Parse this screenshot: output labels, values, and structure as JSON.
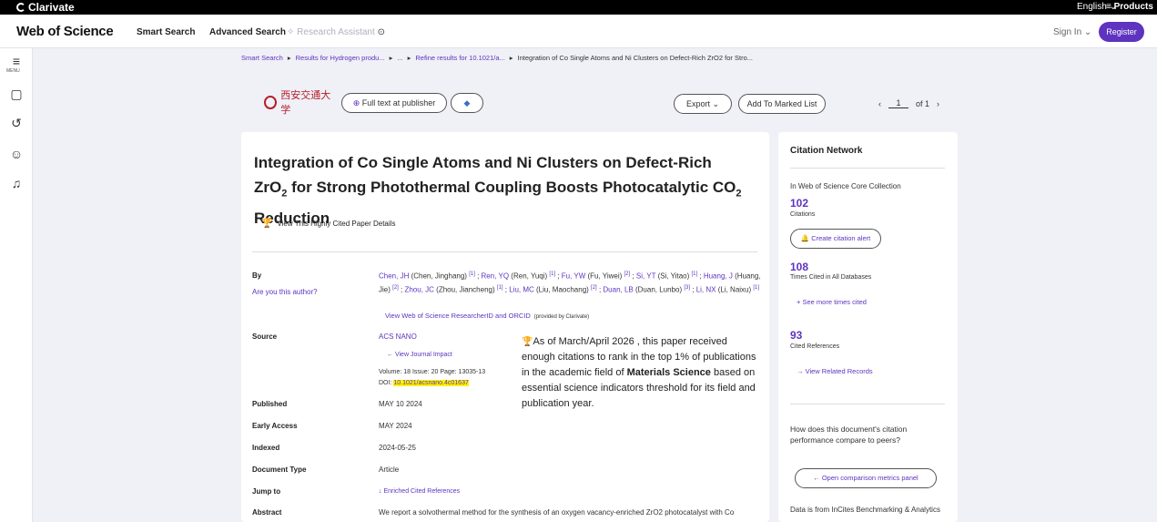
{
  "topbar": {
    "logo": "Clarivate",
    "language": "English ⌄",
    "products": "≡ Products"
  },
  "header": {
    "brand": "Web of Science",
    "nav": [
      "Smart Search",
      "Advanced Search",
      "Research Assistant"
    ],
    "sign_in": "Sign In ⌄",
    "register": "Register"
  },
  "rail": {
    "menu_label": "MENU"
  },
  "breadcrumb": {
    "items": [
      "Smart Search",
      "Results for Hydrogen produ...",
      "...",
      "Refine results for 10.1021/a...",
      "Integration of Co Single Atoms and Ni Clusters on Defect-Rich ZrO2 for Stro..."
    ]
  },
  "toolbar": {
    "university": "西安交通大学",
    "full_text": "Full text at publisher",
    "export": "Export ⌄",
    "marked_list": "Add To Marked List",
    "page_current": "1",
    "page_total": "of 1"
  },
  "record": {
    "title_a": "Integration of Co Single Atoms and Ni Clusters on Defect-Rich ZrO",
    "title_sub1": "2",
    "title_b": " for Strong Photothermal Coupling Boosts Photocatalytic CO",
    "title_sub2": "2",
    "title_c": " Reduction",
    "highly_cited_link": "View This Highly Cited Paper Details",
    "labels": {
      "by": "By",
      "source": "Source",
      "published": "Published",
      "early_access": "Early Access",
      "indexed": "Indexed",
      "doc_type": "Document Type",
      "jump_to": "Jump to",
      "abstract": "Abstract"
    },
    "are_you_author": "Are you this author?",
    "authors": [
      {
        "short": "Chen, JH",
        "full": " (Chen, Jinghang) ",
        "aff": "[1]"
      },
      {
        "short": "Ren, YQ",
        "full": " (Ren, Yuqi) ",
        "aff": "[1]"
      },
      {
        "short": "Fu, YW",
        "full": " (Fu, Yiwei) ",
        "aff": "[2]"
      },
      {
        "short": "Si, YT",
        "full": " (Si, Yitao) ",
        "aff": "[1]"
      },
      {
        "short": "Huang, J",
        "full": " (Huang, Jie) ",
        "aff": "[2]"
      },
      {
        "short": "Zhou, JC",
        "full": " (Zhou, Jiancheng) ",
        "aff": "[1]"
      },
      {
        "short": "Liu, MC",
        "full": " (Liu, Maochang) ",
        "aff": "[2]"
      },
      {
        "short": "Duan, LB",
        "full": " (Duan, Lunbo) ",
        "aff": "[3]"
      },
      {
        "short": "Li, NX",
        "full": " (Li, Naixu) ",
        "aff": "[1]"
      }
    ],
    "researcher_link": "View Web of Science ResearcherID and ORCID",
    "provided_by": "(provided by Clarivate)",
    "source": "ACS NANO",
    "journal_impact": "View Journal Impact",
    "volume_line": "Volume: 18    Issue: 20    Page: 13035-13",
    "doi_label": "DOI: ",
    "doi": "10.1021/acsnano.4c01637",
    "published": "MAY 10 2024",
    "early_access": "MAY 2024",
    "indexed": "2024-05-25",
    "doc_type": "Article",
    "jump_to": "Enriched Cited References",
    "abstract": "We report a solvothermal method for the synthesis of an oxygen vacancy-enriched ZrO2 photocatalyst with Co",
    "hc_note_a": "As of March/April 2026 , this paper received enough citations to rank in the top 1% of publications in the academic field of ",
    "hc_note_field": "Materials Science",
    "hc_note_b": " based on essential science indicators threshold for its field and publication year."
  },
  "citation_network": {
    "heading": "Citation Network",
    "core_collection": "In Web of Science Core Collection",
    "citations": "102",
    "citations_label": "Citations",
    "create_alert": "Create citation alert",
    "times_cited_all": "108",
    "times_cited_all_label": "Times Cited in All Databases",
    "see_more": "See more times cited",
    "cited_refs": "93",
    "cited_refs_label": "Cited References",
    "related": "View Related Records",
    "compare_q": "How does this document's citation performance compare to peers?",
    "compare_btn": "Open comparison metrics panel",
    "data_from": "Data is from InCites Benchmarking & Analytics"
  },
  "colors": {
    "accent": "#5e33bf",
    "trophy": "#b4202a",
    "highlight": "#fff200"
  }
}
